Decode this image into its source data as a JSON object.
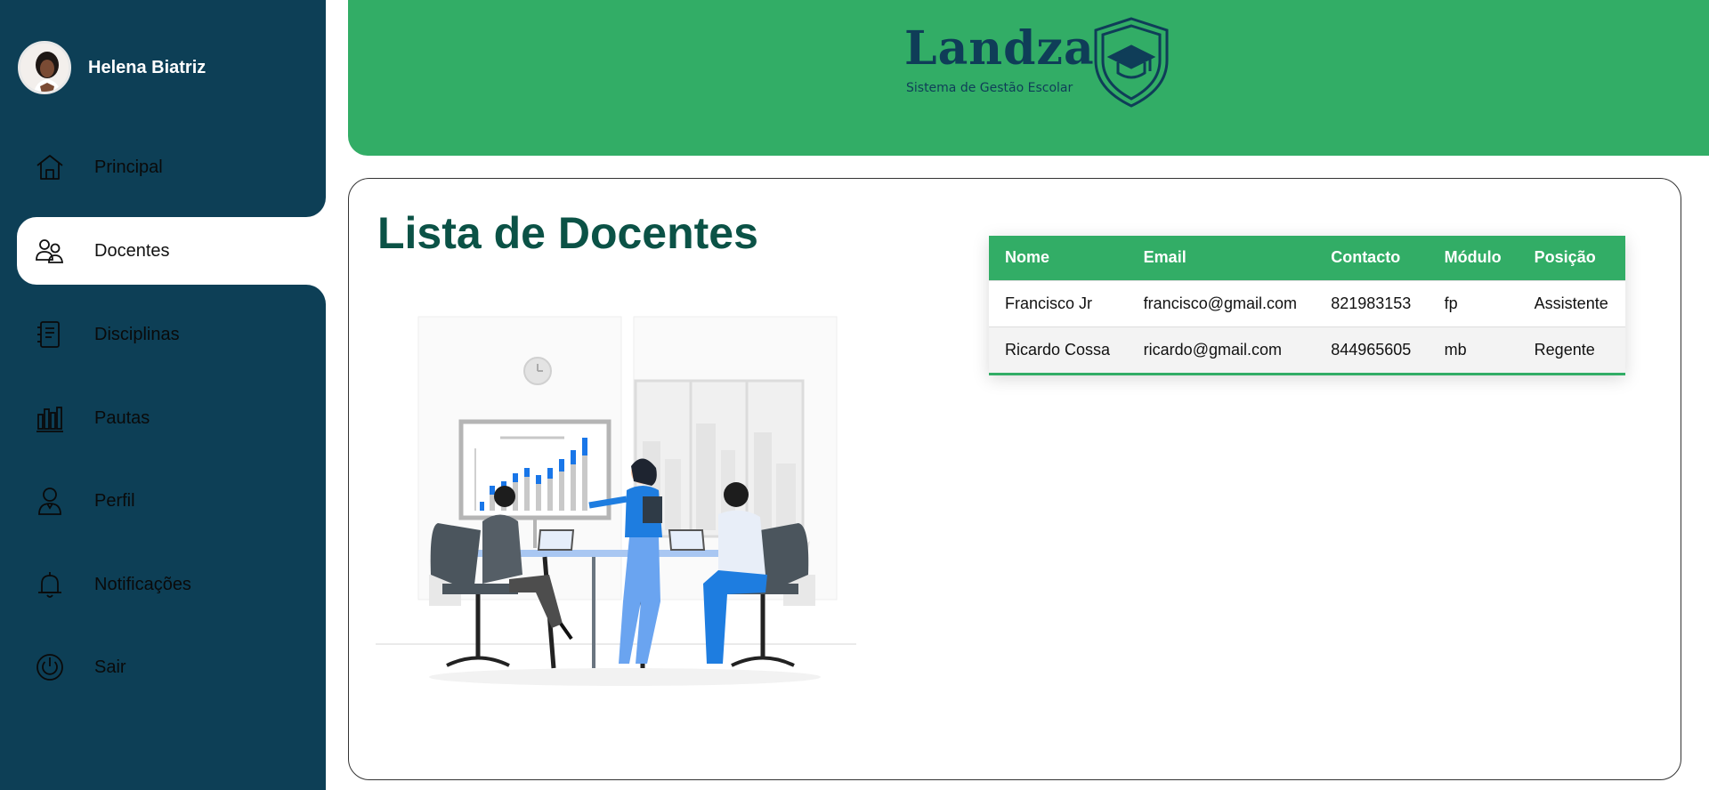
{
  "sidebar": {
    "user_name": "Helena Biatriz",
    "items": [
      {
        "label": "Principal",
        "icon": "home-icon"
      },
      {
        "label": "Docentes",
        "icon": "users-icon",
        "active": true
      },
      {
        "label": "Disciplinas",
        "icon": "book-icon"
      },
      {
        "label": "Pautas",
        "icon": "bar-chart-icon"
      },
      {
        "label": "Perfil",
        "icon": "user-icon"
      },
      {
        "label": "Notificações",
        "icon": "bell-icon"
      },
      {
        "label": "Sair",
        "icon": "power-icon"
      }
    ]
  },
  "header": {
    "logo_title": "Landza",
    "logo_subtitle": "Sistema de Gestão Escolar"
  },
  "main": {
    "title": "Lista de Docentes",
    "table": {
      "columns": [
        "Nome",
        "Email",
        "Contacto",
        "Módulo",
        "Posição"
      ],
      "rows": [
        [
          "Francisco Jr",
          "francisco@gmail.com",
          "821983153",
          "fp",
          "Assistente"
        ],
        [
          "Ricardo Cossa",
          "ricardo@gmail.com",
          "844965605",
          "mb",
          "Regente"
        ]
      ]
    }
  },
  "colors": {
    "sidebar": "#0d3f56",
    "header": "#32ad66",
    "title": "#0b5246"
  }
}
